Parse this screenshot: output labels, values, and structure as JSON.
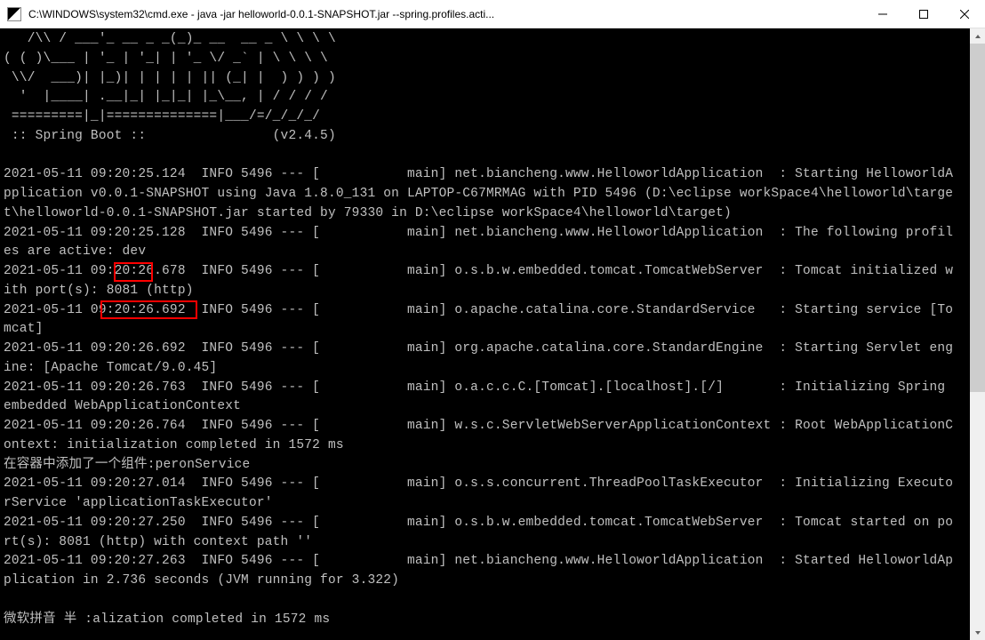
{
  "window": {
    "title": "C:\\WINDOWS\\system32\\cmd.exe - java  -jar helloworld-0.0.1-SNAPSHOT.jar  --spring.profiles.acti..."
  },
  "banner": {
    "l1": "   /\\\\ / ___'_ __ _ _(_)_ __  __ _ \\ \\ \\ \\",
    "l2": "( ( )\\___ | '_ | '_| | '_ \\/ _` | \\ \\ \\ \\",
    "l3": " \\\\/  ___)| |_)| | | | | || (_| |  ) ) ) )",
    "l4": "  '  |____| .__|_| |_|_| |_\\__, | / / / /",
    "l5": " =========|_|==============|___/=/_/_/_/",
    "l6": " :: Spring Boot ::                (v2.4.5)"
  },
  "logs": {
    "line1": "2021-05-11 09:20:25.124  INFO 5496 --- [           main] net.biancheng.www.HelloworldApplication  : Starting HelloworldA",
    "line2": "pplication v0.0.1-SNAPSHOT using Java 1.8.0_131 on LAPTOP-C67MRMAG with PID 5496 (D:\\eclipse workSpace4\\helloworld\\targe",
    "line3": "t\\helloworld-0.0.1-SNAPSHOT.jar started by 79330 in D:\\eclipse workSpace4\\helloworld\\target)",
    "line4_a": "2021-05-11 09:20:25.128  INFO 5496 --- [           main] net.biancheng.www.HelloworldApplication  : The following profil",
    "line4_b": "es are active: ",
    "line4_c": "dev",
    "line5_a": "2021-05-11 09:20:26.678  INFO 5496 --- [           main] o.s.b.w.embedded.tomcat.TomcatWebServer  : Tomcat initialized w",
    "line5_b": "ith port(s): ",
    "line5_c": "8081 (http)",
    "line6": "2021-05-11 09:20:26.692  INFO 5496 --- [           main] o.apache.catalina.core.StandardService   : Starting service [To",
    "line7": "mcat]",
    "line8": "2021-05-11 09:20:26.692  INFO 5496 --- [           main] org.apache.catalina.core.StandardEngine  : Starting Servlet eng",
    "line9": "ine: [Apache Tomcat/9.0.45]",
    "line10": "2021-05-11 09:20:26.763  INFO 5496 --- [           main] o.a.c.c.C.[Tomcat].[localhost].[/]       : Initializing Spring ",
    "line11": "embedded WebApplicationContext",
    "line12": "2021-05-11 09:20:26.764  INFO 5496 --- [           main] w.s.c.ServletWebServerApplicationContext : Root WebApplicationC",
    "line13": "ontext: initialization completed in 1572 ms",
    "line14": "在容器中添加了一个组件:peronService",
    "line15": "2021-05-11 09:20:27.014  INFO 5496 --- [           main] o.s.s.concurrent.ThreadPoolTaskExecutor  : Initializing Executo",
    "line16": "rService 'applicationTaskExecutor'",
    "line17": "2021-05-11 09:20:27.250  INFO 5496 --- [           main] o.s.b.w.embedded.tomcat.TomcatWebServer  : Tomcat started on po",
    "line18": "rt(s): 8081 (http) with context path ''",
    "line19": "2021-05-11 09:20:27.263  INFO 5496 --- [           main] net.biancheng.www.HelloworldApplication  : Started HelloworldAp",
    "line20": "plication in 2.736 seconds (JVM running for 3.322)",
    "line21": "",
    "line22": "微软拼音 半 :alization completed in 1572 ms"
  },
  "highlights": {
    "dev": "dev",
    "port": "8081 (http)"
  }
}
